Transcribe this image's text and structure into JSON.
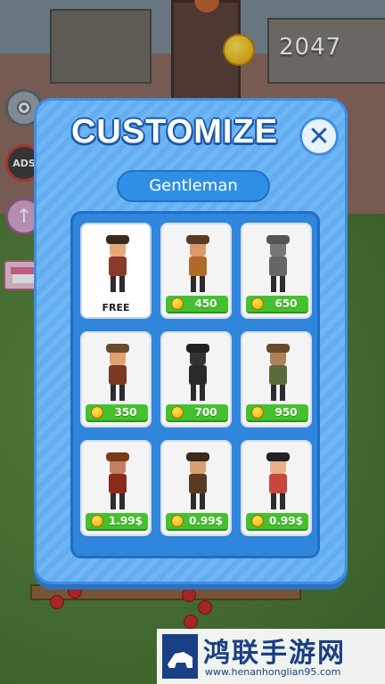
{
  "hud": {
    "coins": "2047",
    "coin_icon": "gold-coin-icon",
    "ads_label": "ADS"
  },
  "panel": {
    "title": "CUSTOMIZE",
    "close_symbol": "✕",
    "selected_name": "Gentleman"
  },
  "characters": [
    {
      "label": "FREE",
      "price": null,
      "hat": "#3a2a1e",
      "skin": "#e8a77a",
      "body": "#8a3a2a"
    },
    {
      "label": null,
      "price": "450",
      "hat": "#5a3a22",
      "skin": "#d89a6a",
      "body": "#b06a2a"
    },
    {
      "label": null,
      "price": "650",
      "hat": "#555",
      "skin": "#777",
      "body": "#666"
    },
    {
      "label": null,
      "price": "350",
      "hat": "#6d4a2a",
      "skin": "#e0a070",
      "body": "#7a3a22"
    },
    {
      "label": null,
      "price": "700",
      "hat": "#222",
      "skin": "#333",
      "body": "#2a2a2a"
    },
    {
      "label": null,
      "price": "950",
      "hat": "#6b4a2a",
      "skin": "#b0805a",
      "body": "#5a6a3a"
    },
    {
      "label": null,
      "price": "1.99$",
      "hat": "#7a3a1a",
      "skin": "#c08060",
      "body": "#8a2a1a"
    },
    {
      "label": null,
      "price": "0.99$",
      "hat": "#3a2a1a",
      "skin": "#d8a070",
      "body": "#5a3a22"
    },
    {
      "label": null,
      "price": "0.99$",
      "hat": "#222",
      "skin": "#e8b08a",
      "body": "#c8463a"
    }
  ],
  "watermark": {
    "title": "鸿联手游网",
    "url": "www.henanhonglian95.com"
  }
}
